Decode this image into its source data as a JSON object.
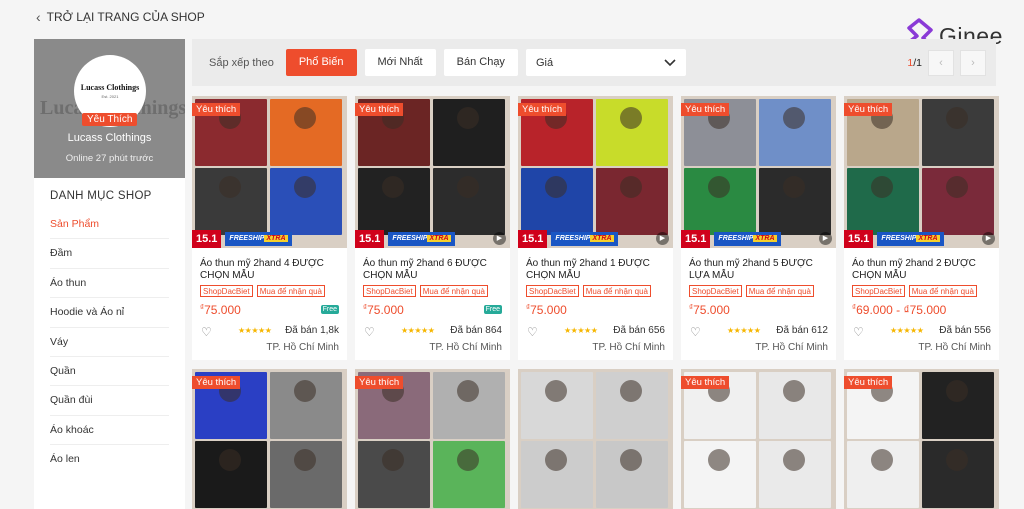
{
  "back": {
    "label": "TRỞ LẠI TRANG CỦA SHOP"
  },
  "brand": {
    "name": "Ginee"
  },
  "shop": {
    "cover_text": "Lucass Clothings",
    "logo_text": "Lucass Clothings",
    "logo_est": "Est. 2021",
    "favorite_label": "Yêu Thích",
    "name": "Lucass Clothings",
    "online": "Online 27 phút trước"
  },
  "categories": {
    "title": "DANH MỤC SHOP",
    "items": [
      "Sản Phẩm",
      "Đầm",
      "Áo thun",
      "Hoodie và Áo nỉ",
      "Váy",
      "Quần",
      "Quần đùi",
      "Áo khoác",
      "Áo len"
    ]
  },
  "sortbar": {
    "label": "Sắp xếp theo",
    "options": [
      "Phổ Biến",
      "Mới Nhất",
      "Bán Chạy"
    ],
    "price_label": "Giá",
    "page_current": "1",
    "page_total": "/1"
  },
  "common": {
    "tag": "Yêu thích",
    "sale": "15.1",
    "freeship": "FREESHIP",
    "xtra": "XTRA",
    "badge1": "ShopDacBiet",
    "badge2": "Mua để nhận quà",
    "currency": "₫",
    "stars": "★★★★★",
    "freeship_icon": "Free"
  },
  "products": [
    {
      "name": "Áo thun mỹ 2hand 4 ĐƯỢC CHỌN MẪU",
      "price": "75.000",
      "sold": "Đã bán 1,8k",
      "location": "TP. Hồ Chí Minh",
      "colors": [
        "#8b2a2f",
        "#e46a24",
        "#3a3a3a",
        "#2a4fb8"
      ]
    },
    {
      "name": "Áo thun mỹ 2hand 6 ĐƯỢC CHỌN MẪU",
      "price": "75.000",
      "sold": "Đã bán 864",
      "location": "TP. Hồ Chí Minh",
      "colors": [
        "#6b2524",
        "#1f1f1f",
        "#222222",
        "#2c2c2c"
      ]
    },
    {
      "name": "Áo thun mỹ 2hand 1 ĐƯỢC CHỌN MẪU",
      "price": "75.000",
      "sold": "Đã bán 656",
      "location": "TP. Hồ Chí Minh",
      "colors": [
        "#b8232a",
        "#c8dc2a",
        "#1f45a8",
        "#7a2730"
      ]
    },
    {
      "name": "Áo thun mỹ 2hand 5 ĐƯỢC LỰA MẪU",
      "price": "75.000",
      "sold": "Đã bán 612",
      "location": "TP. Hồ Chí Minh",
      "colors": [
        "#8d8f97",
        "#6f8fc8",
        "#2a8a42",
        "#2b2b2b"
      ]
    },
    {
      "name": "Áo thun mỹ 2hand 2 ĐƯỢC CHỌN MẪU",
      "price": "69.000 - ₫75.000",
      "sold": "Đã bán 556",
      "location": "TP. Hồ Chí Minh",
      "colors": [
        "#b9a78b",
        "#3b3b3b",
        "#1f6a4a",
        "#7a2a3a"
      ]
    },
    {
      "colors": [
        "#2a3fc4",
        "#8a8a8a",
        "#1a1a1a",
        "#6a6a6a"
      ]
    },
    {
      "colors": [
        "#8a6a7a",
        "#b0b0b0",
        "#4a4a4a",
        "#5ab45a"
      ]
    },
    {
      "colors": [
        "#d8d8d8",
        "#cfcfcf",
        "#cccccc",
        "#c8c8c8"
      ]
    },
    {
      "colors": [
        "#f0f0f0",
        "#e8e8e8",
        "#f4f4f4",
        "#eaeaea"
      ]
    },
    {
      "colors": [
        "#f4f4f4",
        "#222222",
        "#efefef",
        "#2a2a2a"
      ]
    }
  ]
}
